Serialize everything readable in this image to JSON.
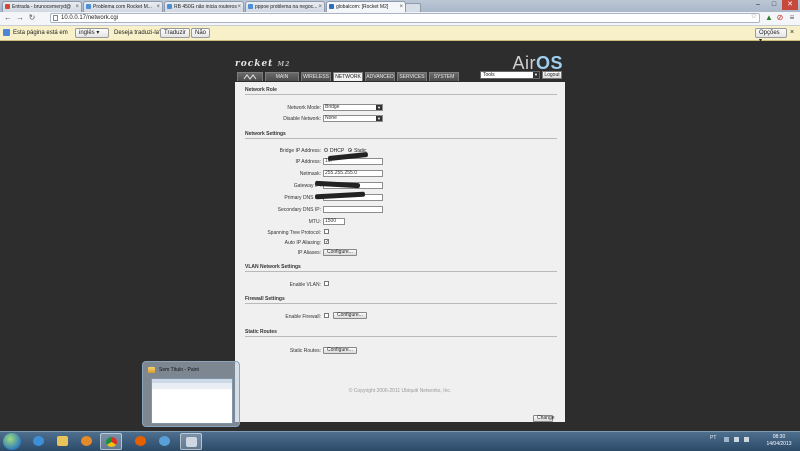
{
  "browser": {
    "tabs": [
      {
        "label": "Entrada - brunocemeryd@",
        "favicon_color": "#d44638",
        "active": false
      },
      {
        "label": "Problema com Rocket M...",
        "favicon_color": "#4a90d9",
        "active": false
      },
      {
        "label": "RB 450G não inicia routeros",
        "favicon_color": "#4a90d9",
        "active": false
      },
      {
        "label": "pppoe problema na negoc...",
        "favicon_color": "#4a90d9",
        "active": false
      },
      {
        "label": "globalcom: [Rocket M2]",
        "favicon_color": "#2a6ebd",
        "active": true
      }
    ],
    "url": "10.0.0.17/network.cgi",
    "window_controls": {
      "minimize": "–",
      "maximize": "□",
      "close": "✕"
    }
  },
  "translate_bar": {
    "prefix": "Esta página está em",
    "language": "inglês",
    "question": "Deseja traduzi-la?",
    "translate_button": "Traduzir",
    "no_button": "Não",
    "options_button": "Opções"
  },
  "airos": {
    "brand_logo": "rocket",
    "brand_model": "M2",
    "product_logo": "Air",
    "product_logo_suffix": "OS",
    "tabs": [
      "MAIN",
      "WIRELESS",
      "NETWORK",
      "ADVANCED",
      "SERVICES",
      "SYSTEM"
    ],
    "active_tab": "NETWORK",
    "tools_select": "Tools",
    "logout_button": "Logout",
    "sections": {
      "network_role": {
        "title": "Network Role",
        "network_mode_label": "Network Mode:",
        "network_mode_value": "Bridge",
        "disable_network_label": "Disable Network:",
        "disable_network_value": "None"
      },
      "network_settings": {
        "title": "Network Settings",
        "bridge_ip_label": "Bridge IP Address:",
        "dhcp_option": "DHCP",
        "static_option": "Static",
        "ip_address_label": "IP Address:",
        "ip_address_value": "10.",
        "netmask_label": "Netmask:",
        "netmask_value": "255.255.255.0",
        "gateway_label": "Gateway IP:",
        "gateway_value": "",
        "primary_dns_label": "Primary DNS IP:",
        "primary_dns_value": "",
        "secondary_dns_label": "Secondary DNS IP:",
        "secondary_dns_value": "",
        "mtu_label": "MTU:",
        "mtu_value": "1500",
        "stp_label": "Spanning Tree Protocol:",
        "stp_checked": false,
        "auto_ip_label": "Auto IP Aliasing:",
        "auto_ip_checked": true,
        "ip_aliases_label": "IP Aliases:",
        "configure_button": "Configure..."
      },
      "vlan": {
        "title": "VLAN Network Settings",
        "enable_vlan_label": "Enable VLAN:",
        "enable_vlan_checked": false
      },
      "firewall": {
        "title": "Firewall Settings",
        "enable_firewall_label": "Enable Firewall:",
        "enable_firewall_checked": false,
        "configure_button": "Configure..."
      },
      "static_routes": {
        "title": "Static Routes",
        "static_routes_label": "Static Routes:",
        "configure_button": "Configure..."
      }
    },
    "change_button": "Change",
    "copyright": "© Copyright 2006-2011 Ubiquiti Networks, Inc."
  },
  "thumbnail": {
    "title": "Sem Título - Paint"
  },
  "taskbar": {
    "tray_lang": "PT",
    "time": "08:30",
    "date": "14/04/2013"
  }
}
